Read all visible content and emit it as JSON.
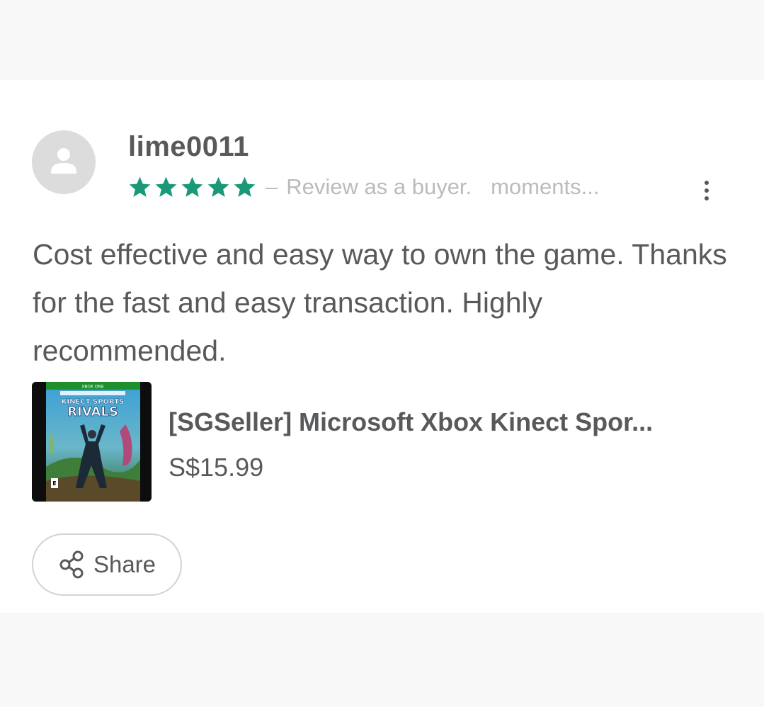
{
  "review": {
    "username": "lime0011",
    "rating": 5,
    "rating_max": 5,
    "star_color": "#1a9978",
    "separator": "–",
    "role": "Review as a buyer.",
    "time": "moments...",
    "text": "Cost effective and easy way to own the game. Thanks for the fast and easy transaction. Highly recommended."
  },
  "product": {
    "title": "[SGSeller] Microsoft Xbox Kinect Spor...",
    "price": "S$15.99",
    "cover_text": {
      "platform": "XBOX ONE",
      "series": "KINECT SPORTS",
      "name": "RIVALS"
    }
  },
  "actions": {
    "share_label": "Share",
    "more_icon": "more-vertical-icon",
    "share_icon": "share-icon"
  }
}
